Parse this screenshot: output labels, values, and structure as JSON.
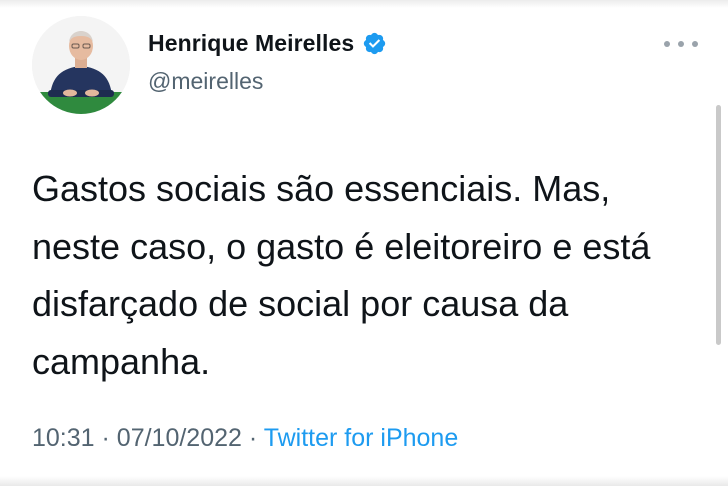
{
  "user": {
    "display_name": "Henrique Meirelles",
    "handle": "@meirelles",
    "verified": true
  },
  "tweet": {
    "text": "Gastos sociais são essenciais. Mas, neste caso, o gasto é eleitoreiro e está disfarçado de social por causa da campanha.",
    "time": "10:31",
    "separator": "·",
    "date": "07/10/2022",
    "source": "Twitter for iPhone"
  },
  "colors": {
    "verified_blue": "#1d9bf0",
    "source_link": "#1d9bf0",
    "secondary_text": "#536471",
    "primary_text": "#0f1419"
  },
  "icons": {
    "verified": "verified-badge-icon",
    "more": "more-options-icon"
  }
}
